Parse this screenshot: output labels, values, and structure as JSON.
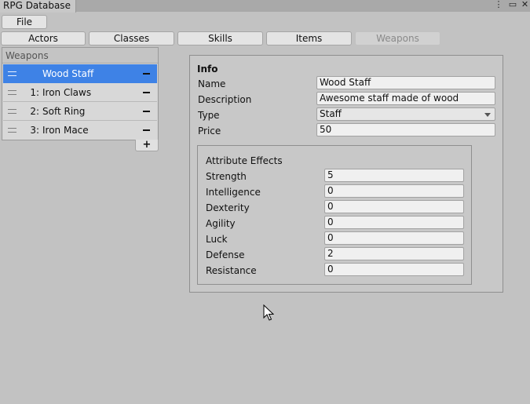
{
  "window": {
    "title": "RPG Database",
    "controls": [
      "⋮",
      "▭",
      "✕"
    ]
  },
  "menu": {
    "file": "File"
  },
  "tabs": [
    {
      "label": "Actors",
      "active": true
    },
    {
      "label": "Classes",
      "active": true
    },
    {
      "label": "Skills",
      "active": true
    },
    {
      "label": "Items",
      "active": true
    },
    {
      "label": "Weapons",
      "active": false
    }
  ],
  "list": {
    "header": "Weapons",
    "items": [
      {
        "index": "",
        "name": "Wood Staff",
        "selected": true
      },
      {
        "index": "1:",
        "name": "Iron Claws",
        "selected": false
      },
      {
        "index": "2:",
        "name": "Soft Ring",
        "selected": false
      },
      {
        "index": "3:",
        "name": "Iron Mace",
        "selected": false
      }
    ],
    "add_label": "+"
  },
  "info": {
    "title": "Info",
    "name_label": "Name",
    "name_value": "Wood Staff",
    "description_label": "Description",
    "description_value": "Awesome staff made of wood",
    "type_label": "Type",
    "type_value": "Staff",
    "price_label": "Price",
    "price_value": "50"
  },
  "attributes": {
    "title": "Attribute Effects",
    "items": [
      {
        "label": "Strength",
        "value": "5"
      },
      {
        "label": "Intelligence",
        "value": "0"
      },
      {
        "label": "Dexterity",
        "value": "0"
      },
      {
        "label": "Agility",
        "value": "0"
      },
      {
        "label": "Luck",
        "value": "0"
      },
      {
        "label": "Defense",
        "value": "2"
      },
      {
        "label": "Resistance",
        "value": "0"
      }
    ]
  },
  "colors": {
    "selection": "#3e82e6",
    "background": "#c2c2c2"
  }
}
